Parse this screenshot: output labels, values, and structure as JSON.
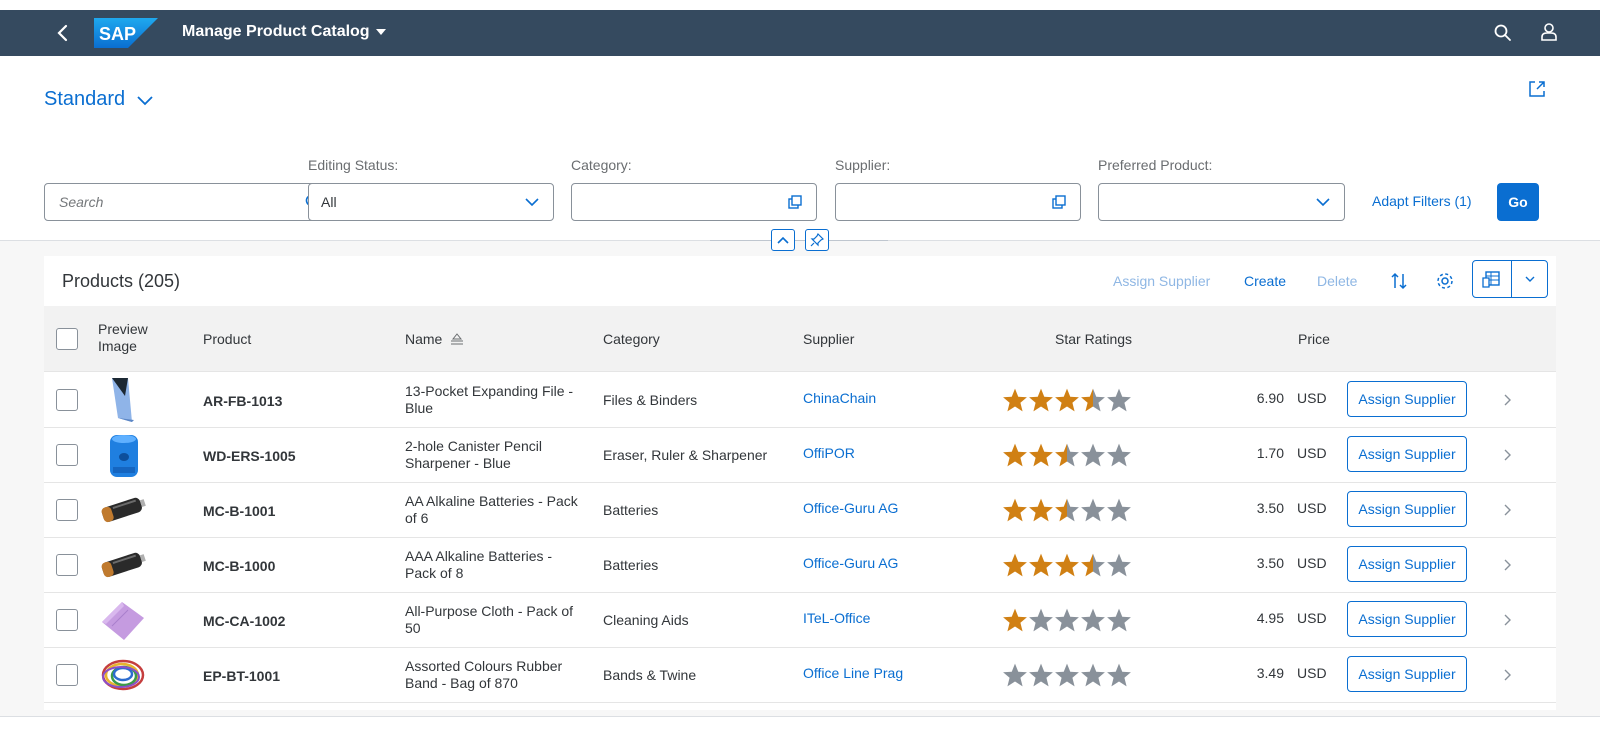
{
  "shell": {
    "back_icon": "chevron-left-icon",
    "logo_text": "SAP",
    "title": "Manage Product Catalog",
    "search_icon": "search-icon",
    "user_icon": "person-icon"
  },
  "variant": {
    "label": "Standard"
  },
  "filters": {
    "search": {
      "placeholder": "Search"
    },
    "editing_status": {
      "label": "Editing Status:",
      "value": "All"
    },
    "category": {
      "label": "Category:",
      "value": ""
    },
    "supplier": {
      "label": "Supplier:",
      "value": ""
    },
    "preferred_product": {
      "label": "Preferred Product:",
      "value": ""
    },
    "adapt_filters_label": "Adapt Filters (1)",
    "go_label": "Go"
  },
  "table": {
    "title": "Products (205)",
    "toolbar": {
      "assign_supplier_label": "Assign Supplier",
      "create_label": "Create",
      "delete_label": "Delete"
    },
    "columns": {
      "preview_image": "Preview Image",
      "product": "Product",
      "name": "Name",
      "category": "Category",
      "supplier": "Supplier",
      "star_ratings": "Star Ratings",
      "price": "Price"
    },
    "assign_button_label": "Assign Supplier",
    "star_colors": {
      "filled": "#d08014",
      "empty": "#89919a"
    },
    "rows": [
      {
        "image": "file-folder",
        "product": "AR-FB-1013",
        "name": "13-Pocket Expanding File - Blue",
        "category": "Files & Binders",
        "supplier": "ChinaChain",
        "rating": 3.5,
        "price": "6.90",
        "currency": "USD"
      },
      {
        "image": "pencil-sharpener",
        "product": "WD-ERS-1005",
        "name": "2-hole Canister Pencil Sharpener - Blue",
        "category": "Eraser, Ruler & Sharpener",
        "supplier": "OffiPOR",
        "rating": 2.5,
        "price": "1.70",
        "currency": "USD"
      },
      {
        "image": "battery",
        "product": "MC-B-1001",
        "name": "AA Alkaline Batteries - Pack of 6",
        "category": "Batteries",
        "supplier": "Office-Guru AG",
        "rating": 2.5,
        "price": "3.50",
        "currency": "USD"
      },
      {
        "image": "battery",
        "product": "MC-B-1000",
        "name": "AAA Alkaline Batteries - Pack of 8",
        "category": "Batteries",
        "supplier": "Office-Guru AG",
        "rating": 3.5,
        "price": "3.50",
        "currency": "USD"
      },
      {
        "image": "cloth",
        "product": "MC-CA-1002",
        "name": "All-Purpose Cloth - Pack of 50",
        "category": "Cleaning Aids",
        "supplier": "ITeL-Office",
        "rating": 1,
        "price": "4.95",
        "currency": "USD"
      },
      {
        "image": "rubber-bands",
        "product": "EP-BT-1001",
        "name": "Assorted Colours Rubber Band - Bag of 870",
        "category": "Bands & Twine",
        "supplier": "Office Line Prag",
        "rating": 0,
        "price": "3.49",
        "currency": "USD"
      }
    ]
  }
}
